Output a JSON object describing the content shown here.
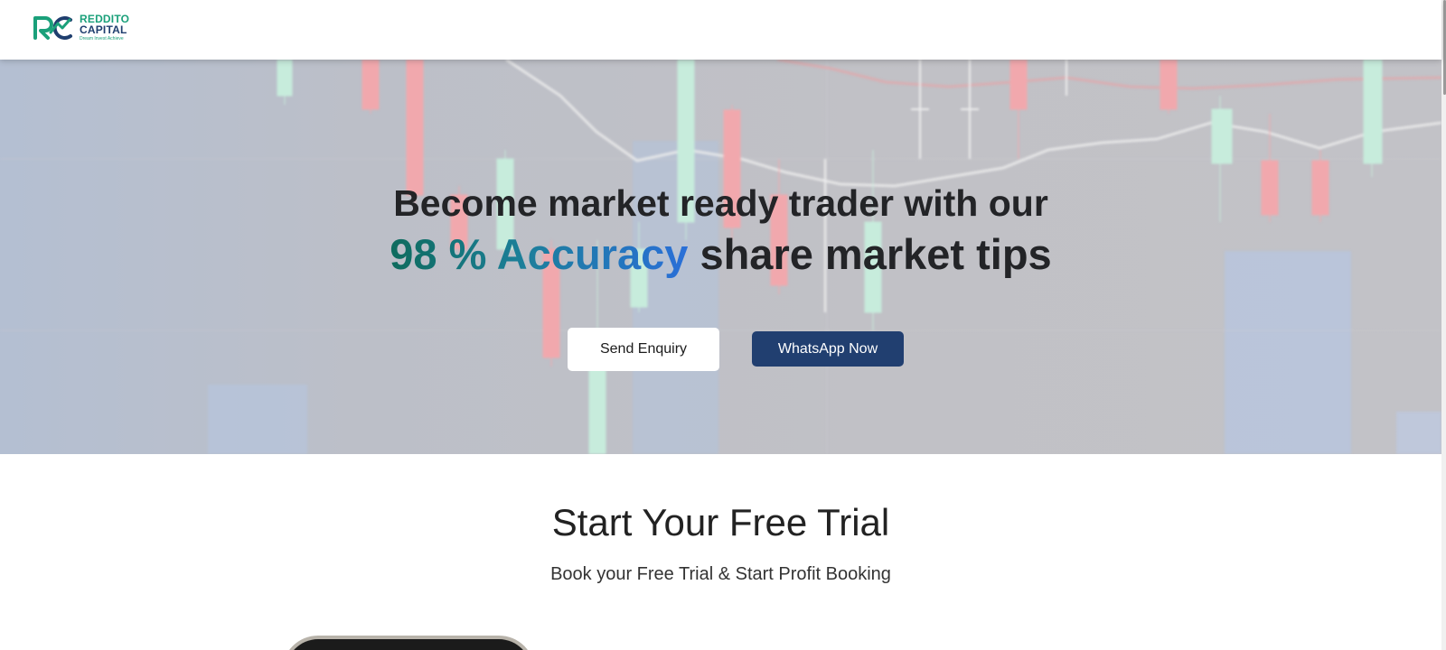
{
  "header": {
    "logo": {
      "line1": "REDDITO",
      "line2": "CAPITAL",
      "tagline": "Dream Invest Achieve",
      "icon": "rc-monogram-icon"
    }
  },
  "hero": {
    "heading_line1": "Become market ready trader with our",
    "accent_text": "98 % Accuracy",
    "heading_line2_rest": "share market tips",
    "primary_button": "Send Enquiry",
    "secondary_button": "WhatsApp Now",
    "accent_colors": [
      "#0e6b5d",
      "#2a6fd8"
    ],
    "button_color": "#213f70"
  },
  "trial": {
    "title": "Start Your Free Trial",
    "subtitle": "Book your Free Trial & Start Profit Booking"
  }
}
